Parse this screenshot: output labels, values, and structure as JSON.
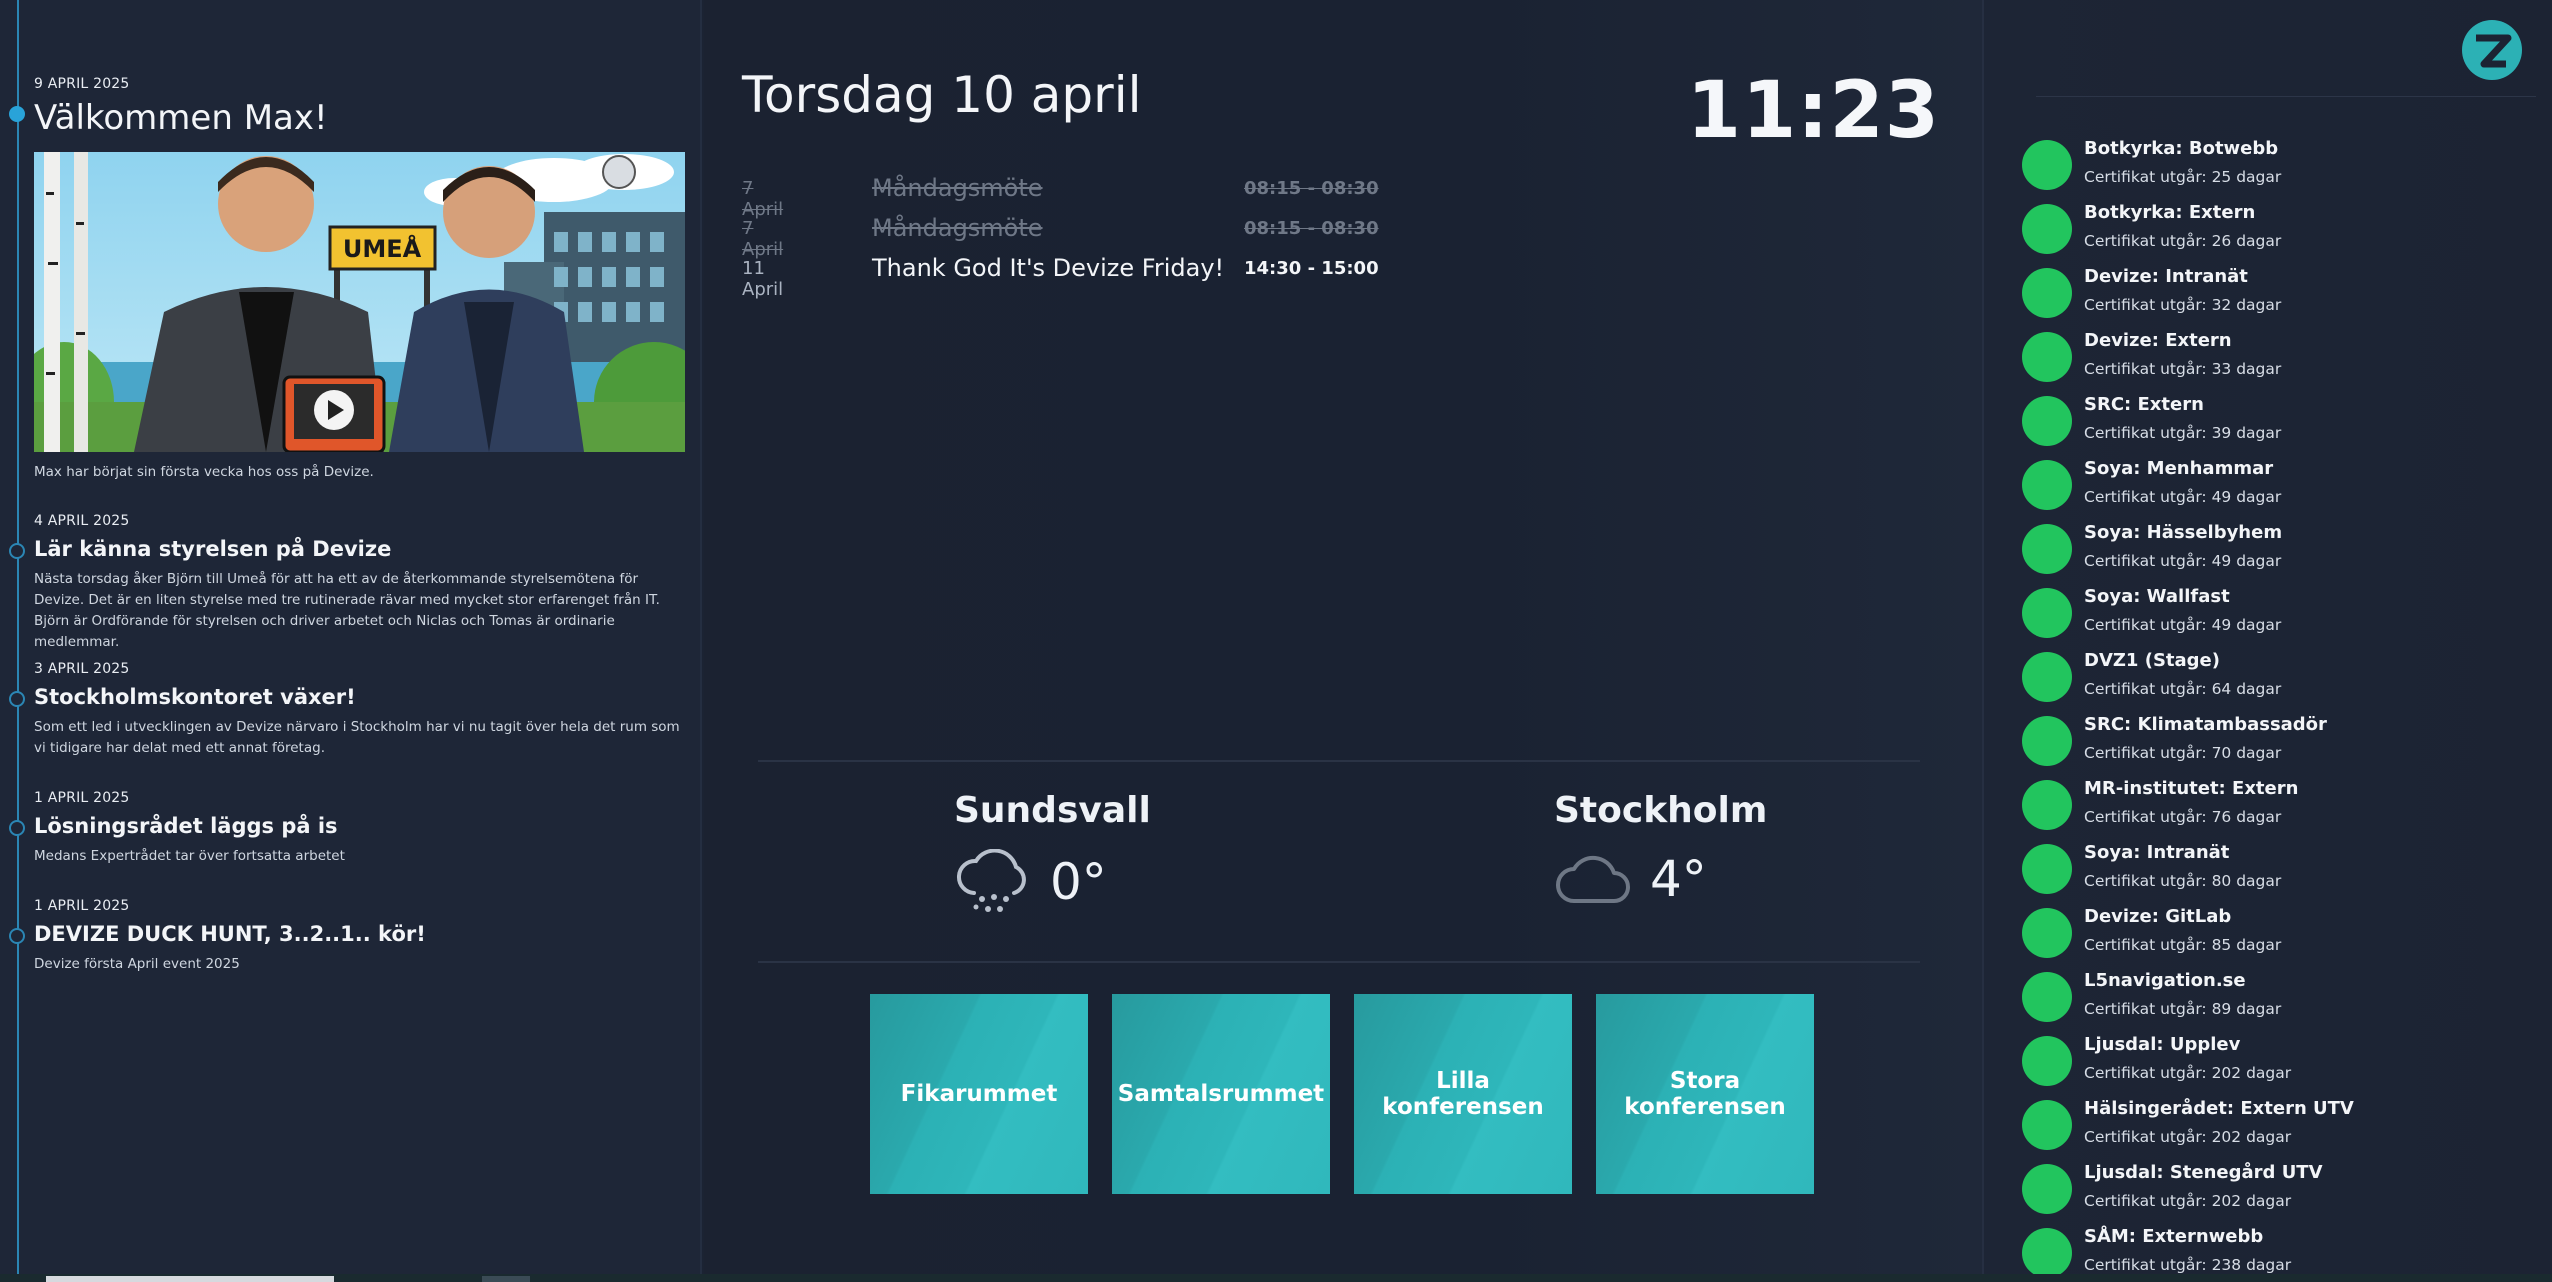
{
  "news": [
    {
      "date": "9 APRIL 2025",
      "title": "Välkommen Max!",
      "image_text": "UMEÅ",
      "text": "Max har börjat sin första vecka hos oss på Devize."
    },
    {
      "date": "4 APRIL 2025",
      "title": "Lär känna styrelsen på Devize",
      "text": "Nästa torsdag åker Björn till Umeå för att ha ett av de återkommande styrelsemötena för Devize. Det är en liten styrelse med tre rutinerade rävar med mycket stor erfarenget från IT. Björn är Ordförande för styrelsen och driver arbetet och Niclas och Tomas är ordinarie medlemmar."
    },
    {
      "date": "3 APRIL 2025",
      "title": "Stockholmskontoret växer!",
      "text": "Som ett led i utvecklingen av Devize närvaro i Stockholm har vi nu tagit över hela det rum som vi tidigare har delat med ett annat företag."
    },
    {
      "date": "1 APRIL 2025",
      "title": "Lösningsrådet läggs på is",
      "text": "Medans Expertrådet tar över fortsatta arbetet"
    },
    {
      "date": "1 APRIL 2025",
      "title": "DEVIZE DUCK HUNT, 3..2..1.. kör!",
      "text": "Devize första April event 2025"
    }
  ],
  "header": {
    "day": "Torsdag 10 april",
    "time": "11:23"
  },
  "events": [
    {
      "date": "7 April",
      "name": "Måndagsmöte",
      "time": "08:15 - 08:30",
      "past": true
    },
    {
      "date": "7 April",
      "name": "Måndagsmöte",
      "time": "08:15 - 08:30",
      "past": true
    },
    {
      "date": "11 April",
      "name": "Thank God It's Devize Friday!",
      "time": "14:30 - 15:00",
      "past": false
    }
  ],
  "weather": [
    {
      "city": "Sundsvall",
      "temp": "0°",
      "icon": "cloud-snow-icon"
    },
    {
      "city": "Stockholm",
      "temp": "4°",
      "icon": "cloud-icon"
    }
  ],
  "rooms": [
    "Fikarummet",
    "Samtalsrummet",
    "Lilla konferensen",
    "Stora konferensen"
  ],
  "certificates": [
    {
      "name": "Botkyrka: Botwebb",
      "expires": "Certifikat utgår: 25 dagar"
    },
    {
      "name": "Botkyrka: Extern",
      "expires": "Certifikat utgår: 26 dagar"
    },
    {
      "name": "Devize: Intranät",
      "expires": "Certifikat utgår: 32 dagar"
    },
    {
      "name": "Devize: Extern",
      "expires": "Certifikat utgår: 33 dagar"
    },
    {
      "name": "SRC: Extern",
      "expires": "Certifikat utgår: 39 dagar"
    },
    {
      "name": "Soya: Menhammar",
      "expires": "Certifikat utgår: 49 dagar"
    },
    {
      "name": "Soya: Hässelbyhem",
      "expires": "Certifikat utgår: 49 dagar"
    },
    {
      "name": "Soya: Wallfast",
      "expires": "Certifikat utgår: 49 dagar"
    },
    {
      "name": "DVZ1 (Stage)",
      "expires": "Certifikat utgår: 64 dagar"
    },
    {
      "name": "SRC: Klimatambassadör",
      "expires": "Certifikat utgår: 70 dagar"
    },
    {
      "name": "MR-institutet: Extern",
      "expires": "Certifikat utgår: 76 dagar"
    },
    {
      "name": "Soya: Intranät",
      "expires": "Certifikat utgår: 80 dagar"
    },
    {
      "name": "Devize: GitLab",
      "expires": "Certifikat utgår: 85 dagar"
    },
    {
      "name": "L5navigation.se",
      "expires": "Certifikat utgår: 89 dagar"
    },
    {
      "name": "Ljusdal: Upplev",
      "expires": "Certifikat utgår: 202 dagar"
    },
    {
      "name": "Hälsingerådet: Extern UTV",
      "expires": "Certifikat utgår: 202 dagar"
    },
    {
      "name": "Ljusdal: Stenegård UTV",
      "expires": "Certifikat utgår: 202 dagar"
    },
    {
      "name": "SÅM: Externwebb",
      "expires": "Certifikat utgår: 238 dagar"
    }
  ],
  "colors": {
    "accent": "#29a3d9",
    "room_tile": "#2cb1b5",
    "status_ok": "#22c55e",
    "background": "#1b2333"
  }
}
